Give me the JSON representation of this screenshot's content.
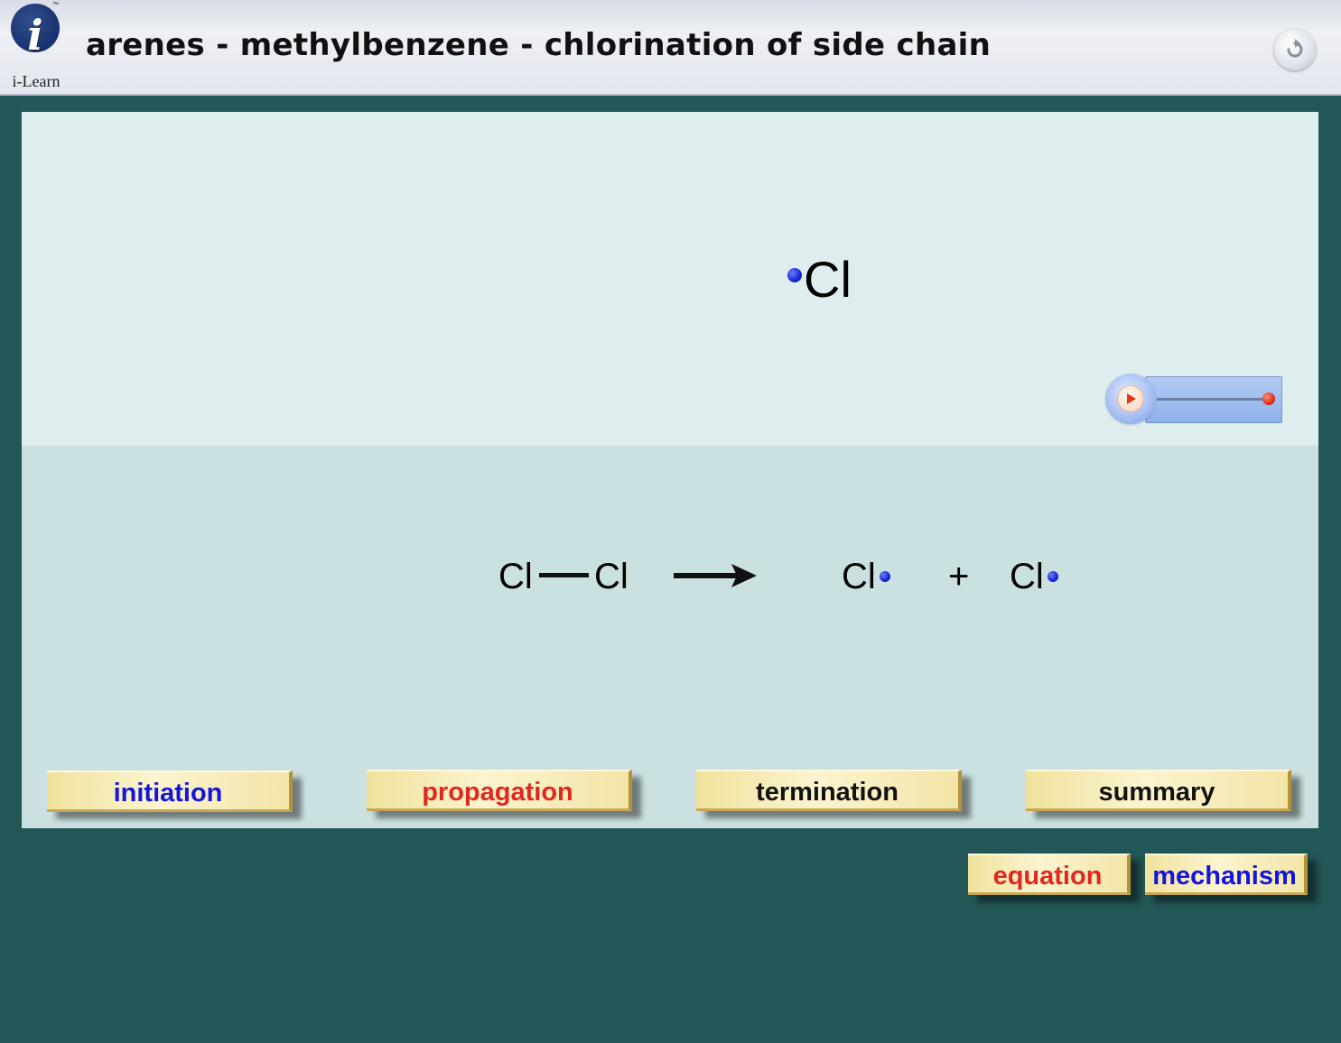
{
  "header": {
    "logo_text": "i-Learn",
    "logo_letter": "i",
    "logo_tm": "™",
    "title": "arenes - methylbenzene - chlorination of side chain",
    "reset_icon": "reset-icon"
  },
  "display": {
    "radical_symbol": "Cl"
  },
  "player": {
    "play_icon": "play-icon",
    "progress": 1.0
  },
  "equation": {
    "reactant_left": "Cl",
    "reactant_right": "Cl",
    "product1": "Cl",
    "plus": "+",
    "product2": "Cl"
  },
  "steps": {
    "initiation": "initiation",
    "propagation": "propagation",
    "termination": "termination",
    "summary": "summary"
  },
  "views": {
    "equation": "equation",
    "mechanism": "mechanism"
  },
  "colors": {
    "background": "#235656",
    "stage_top": "#deeded",
    "stage_bottom": "#cbe1e1",
    "electron_dot": "#1524d0",
    "blue_label": "#1515d9",
    "red_label": "#e0281e",
    "black_label": "#111111"
  }
}
